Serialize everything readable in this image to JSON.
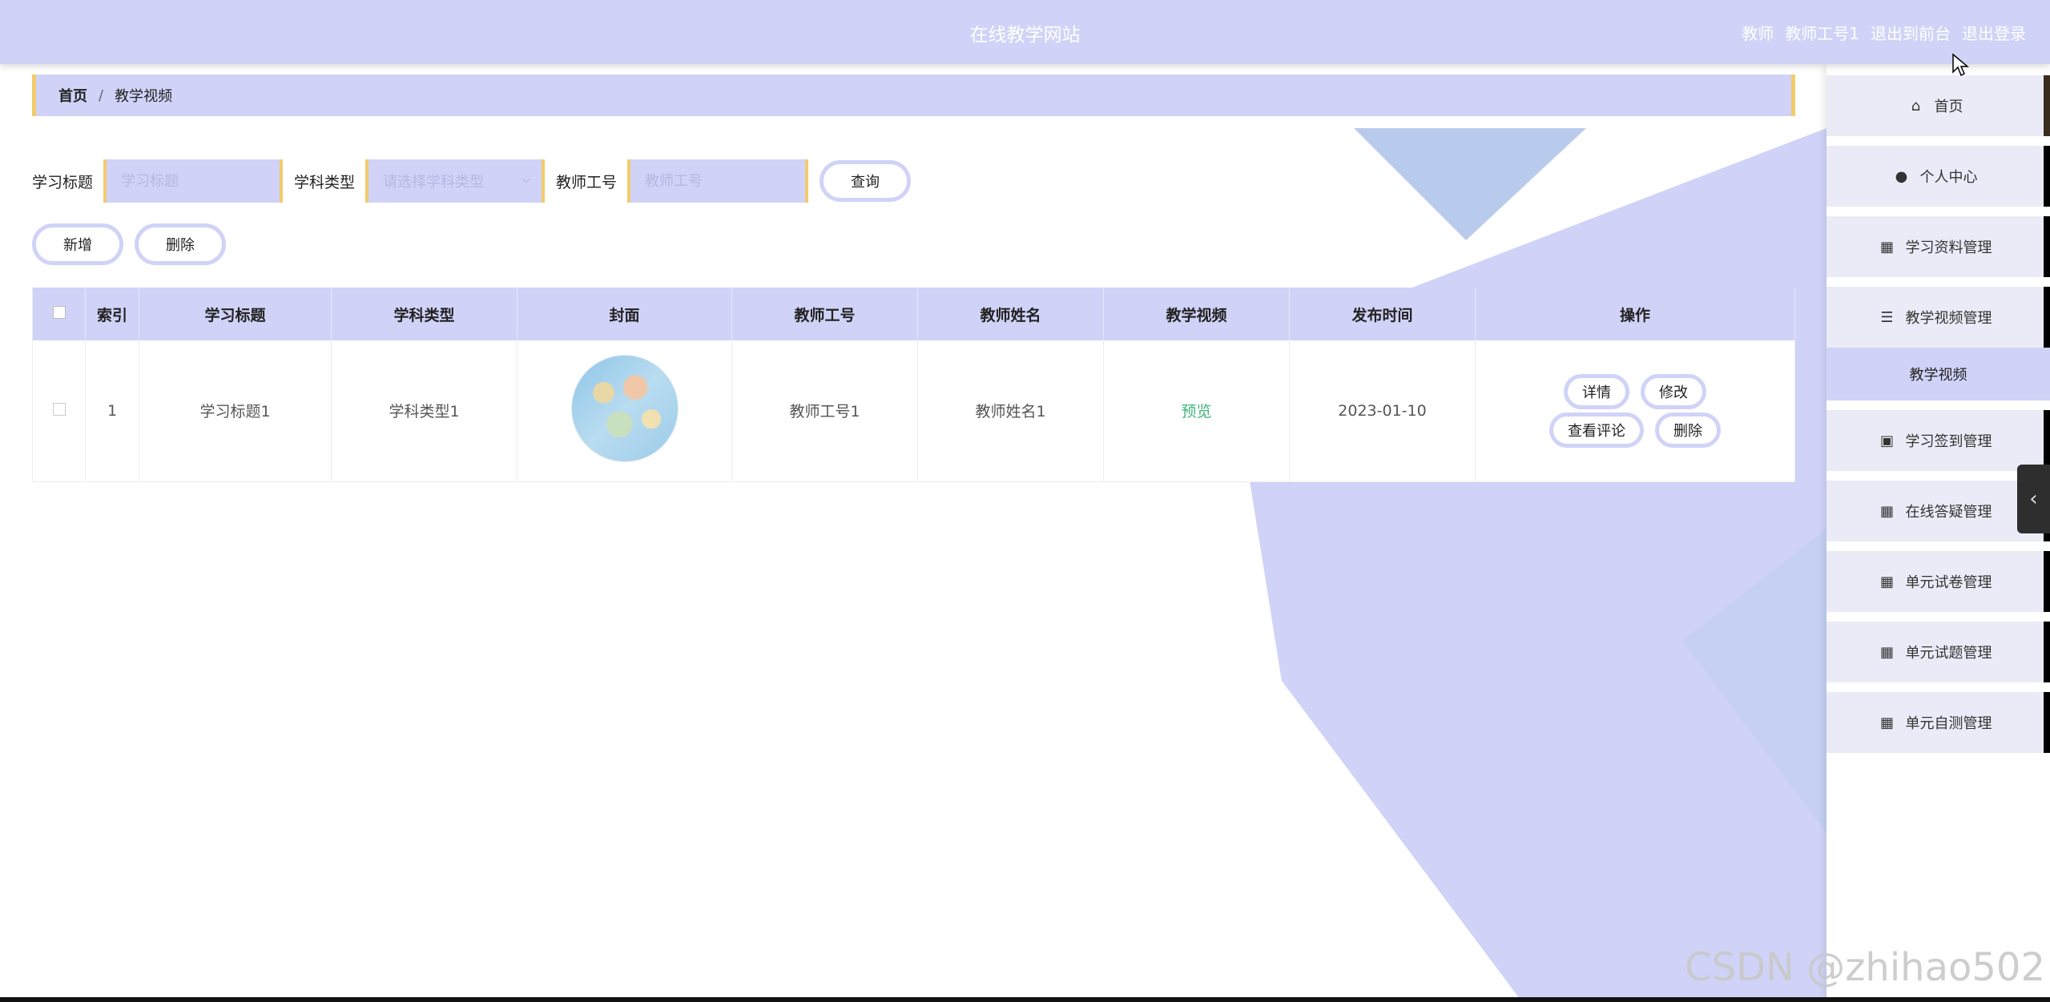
{
  "header": {
    "site_title": "在线教学网站",
    "role": "教师",
    "username": "教师工号1",
    "to_frontend": "退出到前台",
    "logout": "退出登录"
  },
  "breadcrumb": {
    "home": "首页",
    "separator": "/",
    "current": "教学视频"
  },
  "search": {
    "title_label": "学习标题",
    "title_placeholder": "学习标题",
    "subject_label": "学科类型",
    "subject_placeholder": "请选择学科类型",
    "teacher_no_label": "教师工号",
    "teacher_no_placeholder": "教师工号",
    "query_button": "查询"
  },
  "actions": {
    "add": "新增",
    "delete": "删除"
  },
  "table": {
    "headers": [
      "索引",
      "学习标题",
      "学科类型",
      "封面",
      "教师工号",
      "教师姓名",
      "教学视频",
      "发布时间",
      "操作"
    ],
    "rows": [
      {
        "index": "1",
        "title": "学习标题1",
        "subject": "学科类型1",
        "teacher_no": "教师工号1",
        "teacher_name": "教师姓名1",
        "video": "预览",
        "publish_time": "2023-01-10",
        "ops": {
          "detail": "详情",
          "edit": "修改",
          "comments": "查看评论",
          "delete": "删除"
        }
      }
    ]
  },
  "sidebar": {
    "items": [
      {
        "label": "首页",
        "icon": "home-icon"
      },
      {
        "label": "个人中心",
        "icon": "user-icon"
      },
      {
        "label": "学习资料管理",
        "icon": "grid-icon"
      },
      {
        "label": "教学视频管理",
        "icon": "sliders-icon"
      },
      {
        "label": "学习签到管理",
        "icon": "clipboard-icon"
      },
      {
        "label": "在线答疑管理",
        "icon": "grid-icon"
      },
      {
        "label": "单元试卷管理",
        "icon": "grid-icon"
      },
      {
        "label": "单元试题管理",
        "icon": "grid-icon"
      },
      {
        "label": "单元自测管理",
        "icon": "grid-icon"
      }
    ],
    "submenu_active": "教学视频"
  },
  "watermark": "CSDN @zhihao502",
  "colors": {
    "primary": "#d0d3f7",
    "accent": "#f3cb6b",
    "link": "#3fb57a"
  }
}
